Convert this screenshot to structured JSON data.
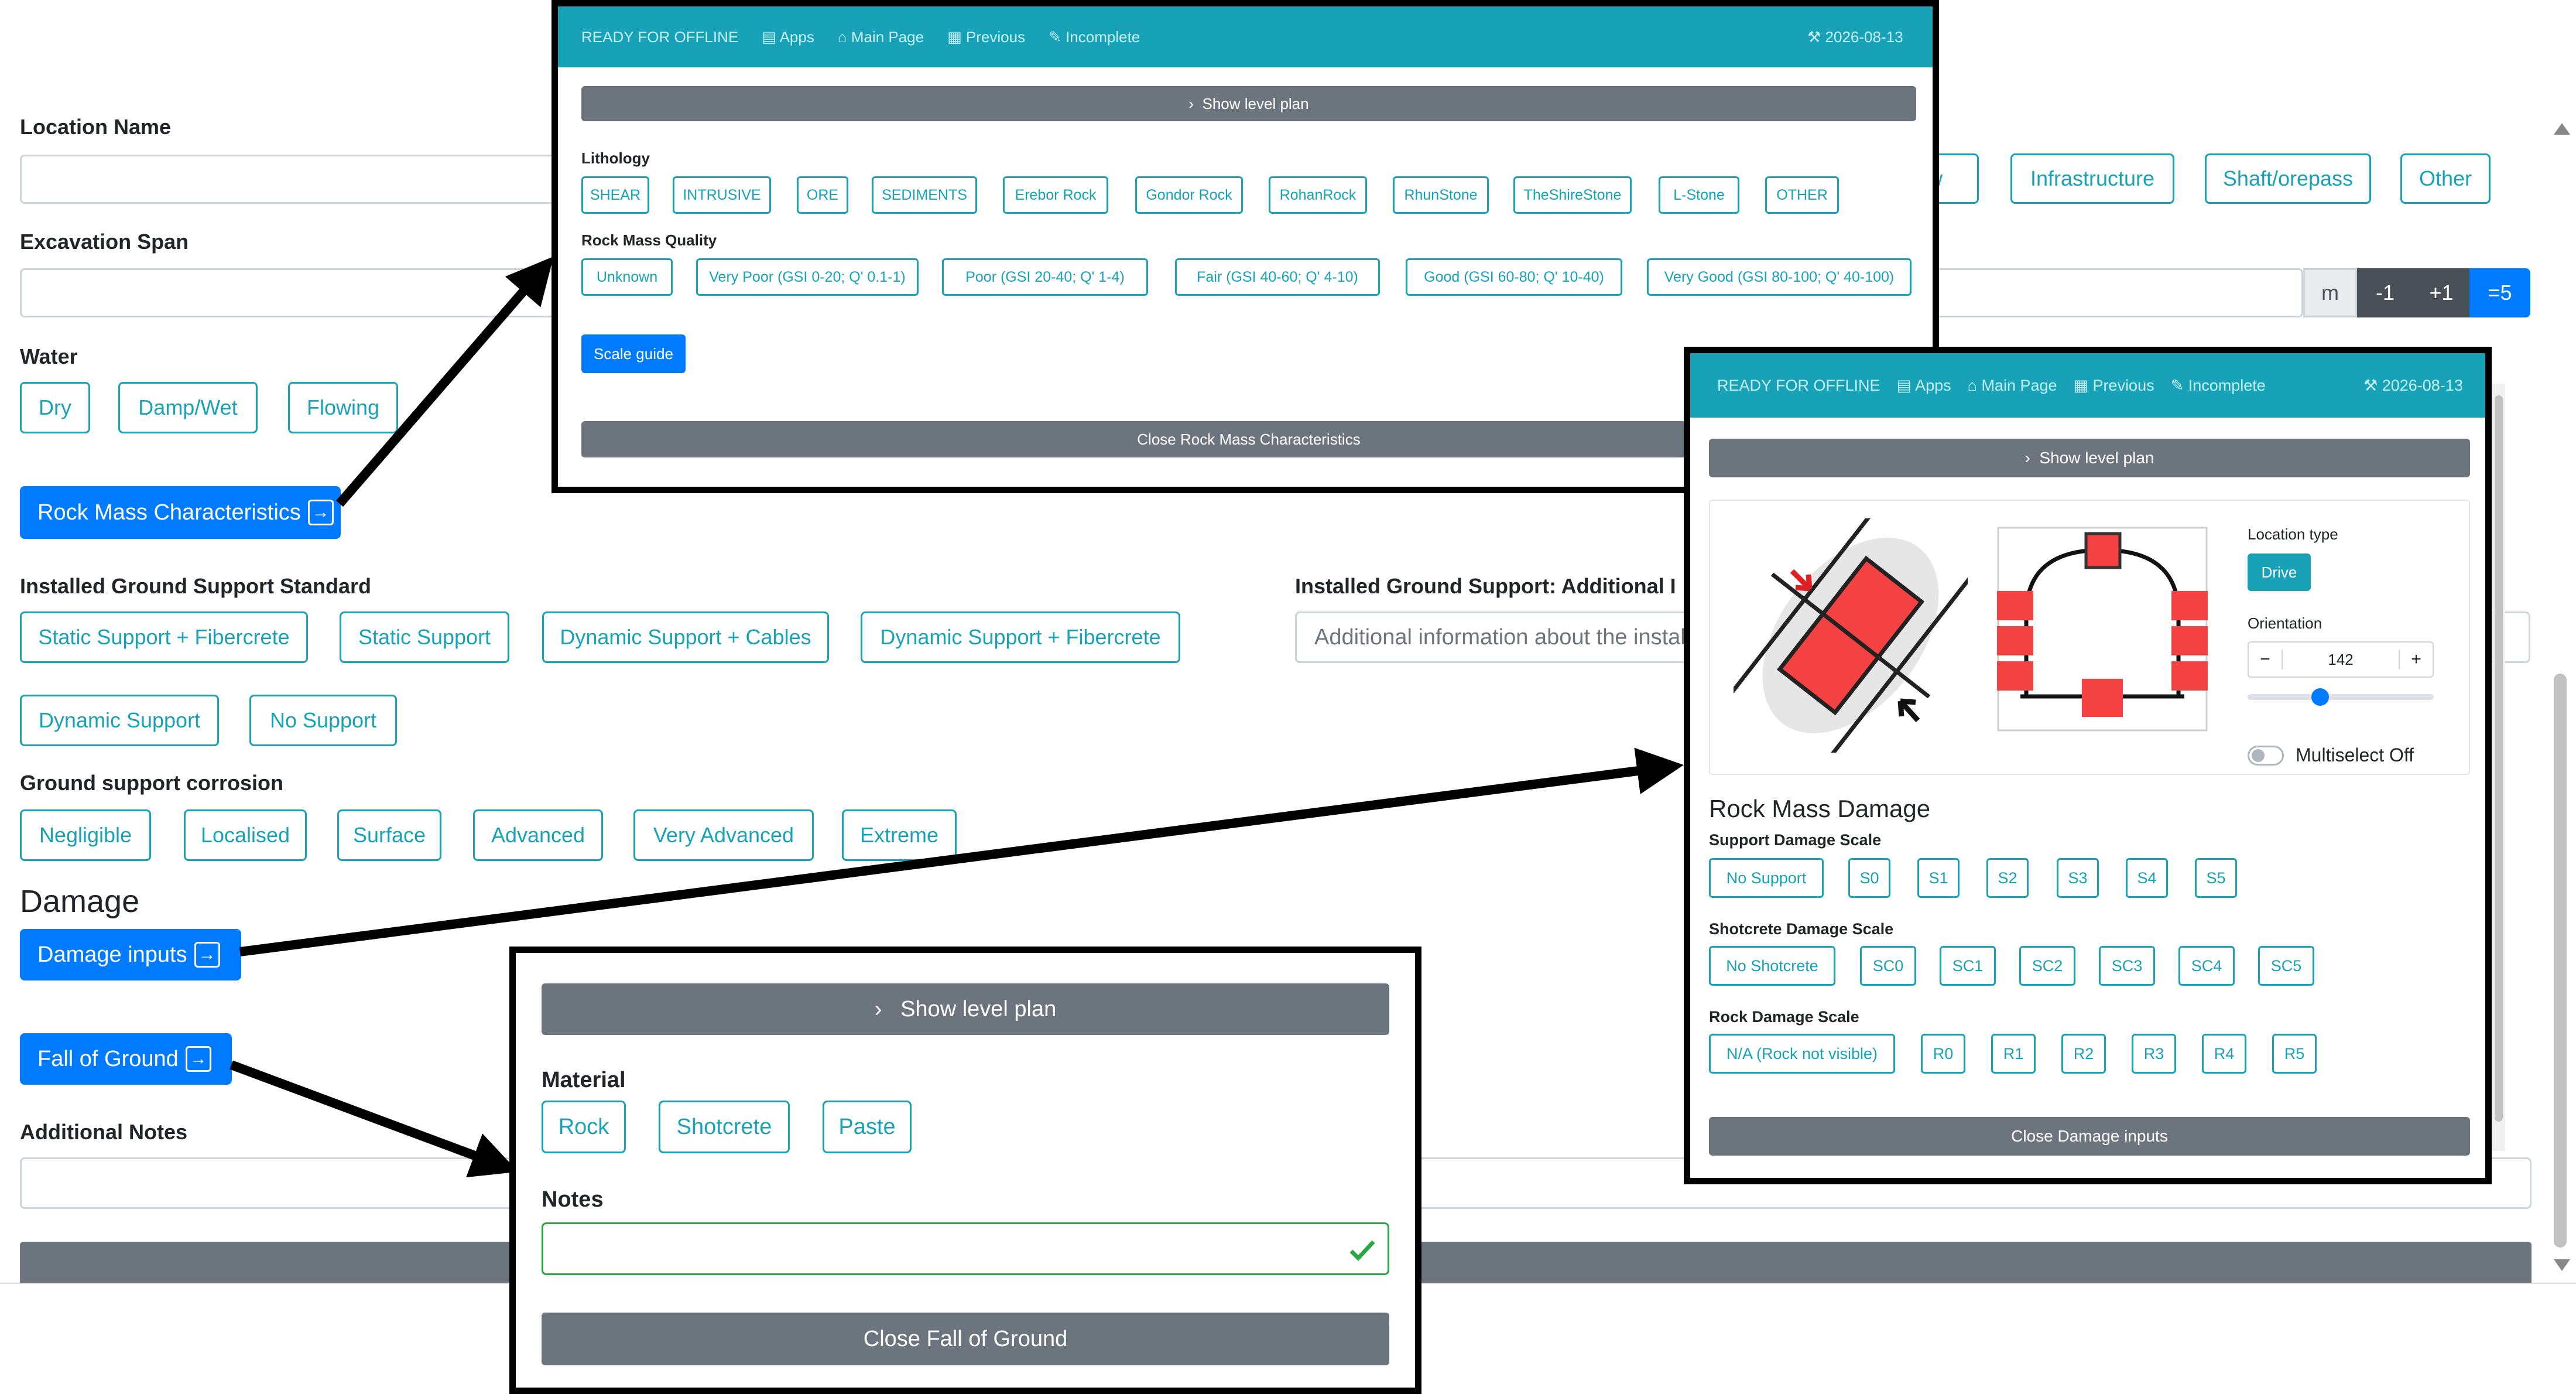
{
  "form": {
    "location_name_label": "Location Name",
    "excavation_span_label": "Excavation Span",
    "water_label": "Water",
    "water_options": [
      "Dry",
      "Damp/Wet",
      "Flowing"
    ],
    "rock_mass_button": "Rock Mass Characteristics",
    "ground_support_std_label": "Installed Ground Support Standard",
    "ground_support_options": [
      "Static Support + Fibercrete",
      "Static Support",
      "Dynamic Support + Cables",
      "Dynamic Support + Fibercrete",
      "Dynamic Support",
      "No Support"
    ],
    "additional_support_label": "Installed Ground Support: Additional I",
    "additional_support_placeholder": "Additional information about the install",
    "corrosion_label": "Ground support corrosion",
    "corrosion_options": [
      "Negligible",
      "Localised",
      "Surface",
      "Advanced",
      "Very Advanced",
      "Extreme"
    ],
    "damage_heading": "Damage",
    "damage_button": "Damage inputs",
    "fog_button": "Fall of Ground",
    "notes_label": "Additional Notes",
    "location_types_partial": [
      "w",
      "Infrastructure",
      "Shaft/orepass",
      "Other"
    ],
    "span_unit": "m",
    "span_steps": [
      "-1",
      "+1",
      "=5"
    ]
  },
  "rock_panel": {
    "topbar": {
      "offline": "READY FOR OFFLINE",
      "apps": "Apps",
      "main": "Main Page",
      "previous": "Previous",
      "incomplete": "Incomplete",
      "date": "2026-08-13"
    },
    "show_plan": "Show level plan",
    "lithology_label": "Lithology",
    "lithology": [
      "SHEAR",
      "INTRUSIVE",
      "ORE",
      "SEDIMENTS",
      "Erebor Rock",
      "Gondor Rock",
      "RohanRock",
      "RhunStone",
      "TheShireStone",
      "L-Stone",
      "OTHER"
    ],
    "quality_label": "Rock Mass Quality",
    "quality": [
      "Unknown",
      "Very Poor (GSI 0-20; Q' 0.1-1)",
      "Poor (GSI 20-40; Q' 1-4)",
      "Fair (GSI 40-60; Q' 4-10)",
      "Good (GSI 60-80; Q' 10-40)",
      "Very Good (GSI 80-100; Q' 40-100)"
    ],
    "scale_guide": "Scale guide",
    "close": "Close Rock Mass Characteristics"
  },
  "damage_panel": {
    "topbar": {
      "offline": "READY FOR OFFLINE",
      "apps": "Apps",
      "main": "Main Page",
      "previous": "Previous",
      "incomplete": "Incomplete",
      "date": "2026-08-13"
    },
    "show_plan": "Show level plan",
    "location_type_label": "Location type",
    "location_type_value": "Drive",
    "orientation_label": "Orientation",
    "orientation_minus": "−",
    "orientation_value": "142",
    "orientation_plus": "+",
    "orientation_slider_fraction": 0.39,
    "multiselect": "Multiselect Off",
    "heading": "Rock Mass Damage",
    "support_label": "Support Damage Scale",
    "support": [
      "No Support",
      "S0",
      "S1",
      "S2",
      "S3",
      "S4",
      "S5"
    ],
    "shotcrete_label": "Shotcrete Damage Scale",
    "shotcrete": [
      "No Shotcrete",
      "SC0",
      "SC1",
      "SC2",
      "SC3",
      "SC4",
      "SC5"
    ],
    "rock_label": "Rock Damage Scale",
    "rock": [
      "N/A (Rock not visible)",
      "R0",
      "R1",
      "R2",
      "R3",
      "R4",
      "R5"
    ],
    "close": "Close Damage inputs"
  },
  "fog_panel": {
    "show_plan": "Show level plan",
    "material_label": "Material",
    "material": [
      "Rock",
      "Shotcrete",
      "Paste"
    ],
    "notes_label": "Notes",
    "close": "Close Fall of Ground"
  },
  "colors": {
    "accent": "#17a2b8",
    "primary": "#007bff",
    "secondary": "#6c757d",
    "success": "#28a745",
    "damage_red": "#f44141"
  }
}
